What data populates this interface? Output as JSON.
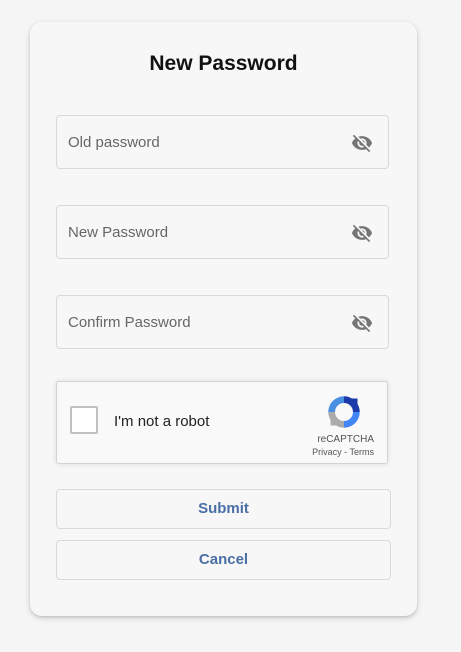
{
  "form": {
    "title": "New Password",
    "fields": [
      {
        "placeholder": "Old password",
        "value": "",
        "icon": "eye-off-icon"
      },
      {
        "placeholder": "New Password",
        "value": "",
        "icon": "eye-off-icon"
      },
      {
        "placeholder": "Confirm Password",
        "value": "",
        "icon": "eye-off-icon"
      }
    ]
  },
  "recaptcha": {
    "label": "I'm not a robot",
    "brand": "reCAPTCHA",
    "privacy": "Privacy",
    "separator": " - ",
    "terms": "Terms",
    "checked": false
  },
  "buttons": {
    "submit": "Submit",
    "cancel": "Cancel"
  },
  "colors": {
    "accent": "#4a6fa5",
    "icon": "#757575"
  }
}
